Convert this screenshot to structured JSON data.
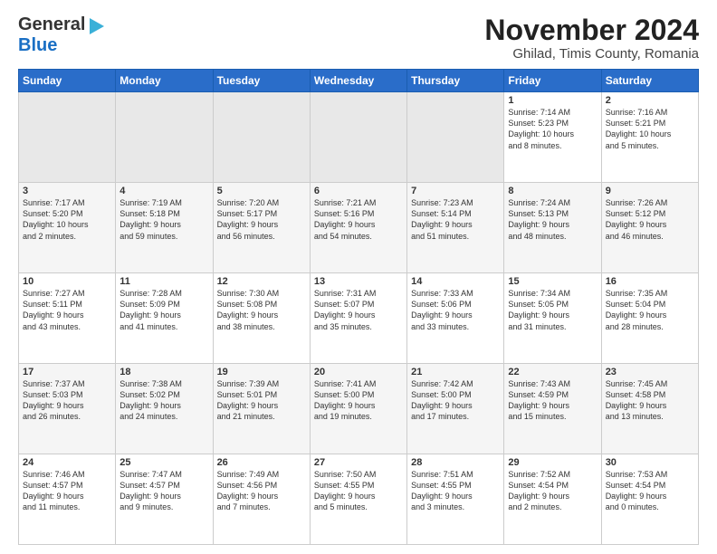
{
  "header": {
    "logo_line1": "General",
    "logo_line2": "Blue",
    "title": "November 2024",
    "subtitle": "Ghilad, Timis County, Romania"
  },
  "days_of_week": [
    "Sunday",
    "Monday",
    "Tuesday",
    "Wednesday",
    "Thursday",
    "Friday",
    "Saturday"
  ],
  "weeks": [
    [
      {
        "day": "",
        "info": ""
      },
      {
        "day": "",
        "info": ""
      },
      {
        "day": "",
        "info": ""
      },
      {
        "day": "",
        "info": ""
      },
      {
        "day": "",
        "info": ""
      },
      {
        "day": "1",
        "info": "Sunrise: 7:14 AM\nSunset: 5:23 PM\nDaylight: 10 hours\nand 8 minutes."
      },
      {
        "day": "2",
        "info": "Sunrise: 7:16 AM\nSunset: 5:21 PM\nDaylight: 10 hours\nand 5 minutes."
      }
    ],
    [
      {
        "day": "3",
        "info": "Sunrise: 7:17 AM\nSunset: 5:20 PM\nDaylight: 10 hours\nand 2 minutes."
      },
      {
        "day": "4",
        "info": "Sunrise: 7:19 AM\nSunset: 5:18 PM\nDaylight: 9 hours\nand 59 minutes."
      },
      {
        "day": "5",
        "info": "Sunrise: 7:20 AM\nSunset: 5:17 PM\nDaylight: 9 hours\nand 56 minutes."
      },
      {
        "day": "6",
        "info": "Sunrise: 7:21 AM\nSunset: 5:16 PM\nDaylight: 9 hours\nand 54 minutes."
      },
      {
        "day": "7",
        "info": "Sunrise: 7:23 AM\nSunset: 5:14 PM\nDaylight: 9 hours\nand 51 minutes."
      },
      {
        "day": "8",
        "info": "Sunrise: 7:24 AM\nSunset: 5:13 PM\nDaylight: 9 hours\nand 48 minutes."
      },
      {
        "day": "9",
        "info": "Sunrise: 7:26 AM\nSunset: 5:12 PM\nDaylight: 9 hours\nand 46 minutes."
      }
    ],
    [
      {
        "day": "10",
        "info": "Sunrise: 7:27 AM\nSunset: 5:11 PM\nDaylight: 9 hours\nand 43 minutes."
      },
      {
        "day": "11",
        "info": "Sunrise: 7:28 AM\nSunset: 5:09 PM\nDaylight: 9 hours\nand 41 minutes."
      },
      {
        "day": "12",
        "info": "Sunrise: 7:30 AM\nSunset: 5:08 PM\nDaylight: 9 hours\nand 38 minutes."
      },
      {
        "day": "13",
        "info": "Sunrise: 7:31 AM\nSunset: 5:07 PM\nDaylight: 9 hours\nand 35 minutes."
      },
      {
        "day": "14",
        "info": "Sunrise: 7:33 AM\nSunset: 5:06 PM\nDaylight: 9 hours\nand 33 minutes."
      },
      {
        "day": "15",
        "info": "Sunrise: 7:34 AM\nSunset: 5:05 PM\nDaylight: 9 hours\nand 31 minutes."
      },
      {
        "day": "16",
        "info": "Sunrise: 7:35 AM\nSunset: 5:04 PM\nDaylight: 9 hours\nand 28 minutes."
      }
    ],
    [
      {
        "day": "17",
        "info": "Sunrise: 7:37 AM\nSunset: 5:03 PM\nDaylight: 9 hours\nand 26 minutes."
      },
      {
        "day": "18",
        "info": "Sunrise: 7:38 AM\nSunset: 5:02 PM\nDaylight: 9 hours\nand 24 minutes."
      },
      {
        "day": "19",
        "info": "Sunrise: 7:39 AM\nSunset: 5:01 PM\nDaylight: 9 hours\nand 21 minutes."
      },
      {
        "day": "20",
        "info": "Sunrise: 7:41 AM\nSunset: 5:00 PM\nDaylight: 9 hours\nand 19 minutes."
      },
      {
        "day": "21",
        "info": "Sunrise: 7:42 AM\nSunset: 5:00 PM\nDaylight: 9 hours\nand 17 minutes."
      },
      {
        "day": "22",
        "info": "Sunrise: 7:43 AM\nSunset: 4:59 PM\nDaylight: 9 hours\nand 15 minutes."
      },
      {
        "day": "23",
        "info": "Sunrise: 7:45 AM\nSunset: 4:58 PM\nDaylight: 9 hours\nand 13 minutes."
      }
    ],
    [
      {
        "day": "24",
        "info": "Sunrise: 7:46 AM\nSunset: 4:57 PM\nDaylight: 9 hours\nand 11 minutes."
      },
      {
        "day": "25",
        "info": "Sunrise: 7:47 AM\nSunset: 4:57 PM\nDaylight: 9 hours\nand 9 minutes."
      },
      {
        "day": "26",
        "info": "Sunrise: 7:49 AM\nSunset: 4:56 PM\nDaylight: 9 hours\nand 7 minutes."
      },
      {
        "day": "27",
        "info": "Sunrise: 7:50 AM\nSunset: 4:55 PM\nDaylight: 9 hours\nand 5 minutes."
      },
      {
        "day": "28",
        "info": "Sunrise: 7:51 AM\nSunset: 4:55 PM\nDaylight: 9 hours\nand 3 minutes."
      },
      {
        "day": "29",
        "info": "Sunrise: 7:52 AM\nSunset: 4:54 PM\nDaylight: 9 hours\nand 2 minutes."
      },
      {
        "day": "30",
        "info": "Sunrise: 7:53 AM\nSunset: 4:54 PM\nDaylight: 9 hours\nand 0 minutes."
      }
    ]
  ]
}
